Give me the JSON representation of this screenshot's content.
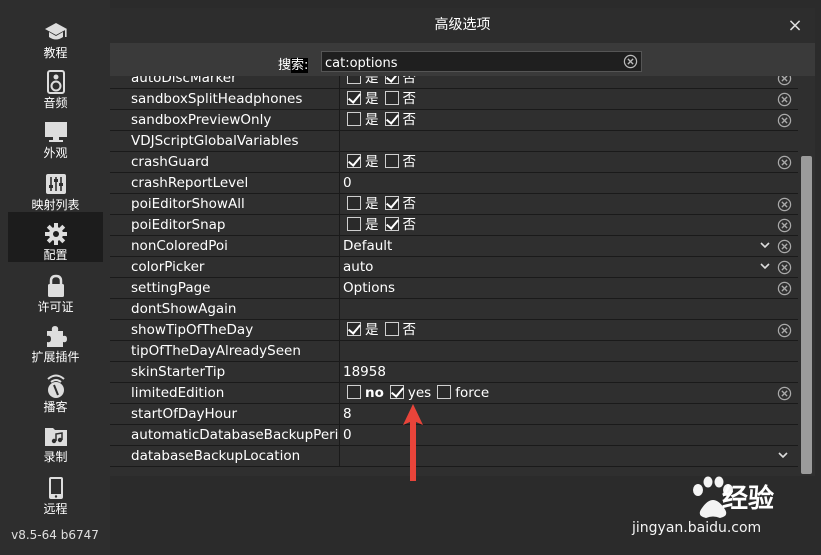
{
  "sidebar": {
    "items": [
      {
        "label": "教程",
        "icon": "graduation-cap-icon",
        "active": false
      },
      {
        "label": "音频",
        "icon": "speaker-icon",
        "active": false
      },
      {
        "label": "外观",
        "icon": "monitor-icon",
        "active": false
      },
      {
        "label": "映射列表",
        "icon": "sliders-icon",
        "active": false
      },
      {
        "label": "配置",
        "icon": "gear-icon",
        "active": true
      },
      {
        "label": "许可证",
        "icon": "lock-icon",
        "active": false
      },
      {
        "label": "扩展插件",
        "icon": "puzzle-icon",
        "active": false
      },
      {
        "label": "播客",
        "icon": "podcast-icon",
        "active": false
      },
      {
        "label": "录制",
        "icon": "folder-music-icon",
        "active": false
      },
      {
        "label": "远程",
        "icon": "phone-icon",
        "active": false
      }
    ],
    "version": "v8.5-64 b6747"
  },
  "dialog": {
    "title": "高级选项",
    "close": "×",
    "search_label_a": "搜",
    "search_label_b": "索:",
    "search_value": "cat:options"
  },
  "options": {
    "yes": "是",
    "no": "否",
    "rows": [
      {
        "key": "autoDiscMarker",
        "type": "bool",
        "yes": false,
        "no": true,
        "clear": true
      },
      {
        "key": "sandboxSplitHeadphones",
        "type": "bool",
        "yes": true,
        "no": false,
        "clear": true
      },
      {
        "key": "sandboxPreviewOnly",
        "type": "bool",
        "yes": false,
        "no": true,
        "clear": true
      },
      {
        "key": "VDJScriptGlobalVariables",
        "type": "text",
        "value": "",
        "clear": false
      },
      {
        "key": "crashGuard",
        "type": "bool",
        "yes": true,
        "no": false,
        "clear": true
      },
      {
        "key": "crashReportLevel",
        "type": "text",
        "value": "0",
        "clear": false
      },
      {
        "key": "poiEditorShowAll",
        "type": "bool",
        "yes": false,
        "no": true,
        "clear": true
      },
      {
        "key": "poiEditorSnap",
        "type": "bool",
        "yes": false,
        "no": true,
        "clear": true
      },
      {
        "key": "nonColoredPoi",
        "type": "select",
        "value": "Default",
        "clear": true
      },
      {
        "key": "colorPicker",
        "type": "select",
        "value": "auto",
        "clear": true
      },
      {
        "key": "settingPage",
        "type": "text",
        "value": "Options",
        "clear": true
      },
      {
        "key": "dontShowAgain",
        "type": "text",
        "value": "",
        "clear": false
      },
      {
        "key": "showTipOfTheDay",
        "type": "bool",
        "yes": true,
        "no": false,
        "clear": true
      },
      {
        "key": "tipOfTheDayAlreadySeen",
        "type": "text",
        "value": "",
        "clear": false
      },
      {
        "key": "skinStarterTip",
        "type": "text",
        "value": "18958",
        "clear": false
      },
      {
        "key": "limitedEdition",
        "type": "tri",
        "options": [
          "no",
          "yes",
          "force"
        ],
        "checked": [
          false,
          true,
          false
        ],
        "clear": true
      },
      {
        "key": "startOfDayHour",
        "type": "text",
        "value": "8",
        "clear": false
      },
      {
        "key": "automaticDatabaseBackupPeriod",
        "type": "text",
        "value": "0",
        "clear": false
      },
      {
        "key": "databaseBackupLocation",
        "type": "select",
        "value": "",
        "clear": false
      }
    ]
  },
  "watermark": {
    "brand": "Bai du",
    "cn": "经验",
    "url": "jingyan.baidu.com"
  },
  "colors": {
    "accent_arrow": "#e8443a",
    "background": "#2b2b2b",
    "panel": "#3a3a3a"
  }
}
